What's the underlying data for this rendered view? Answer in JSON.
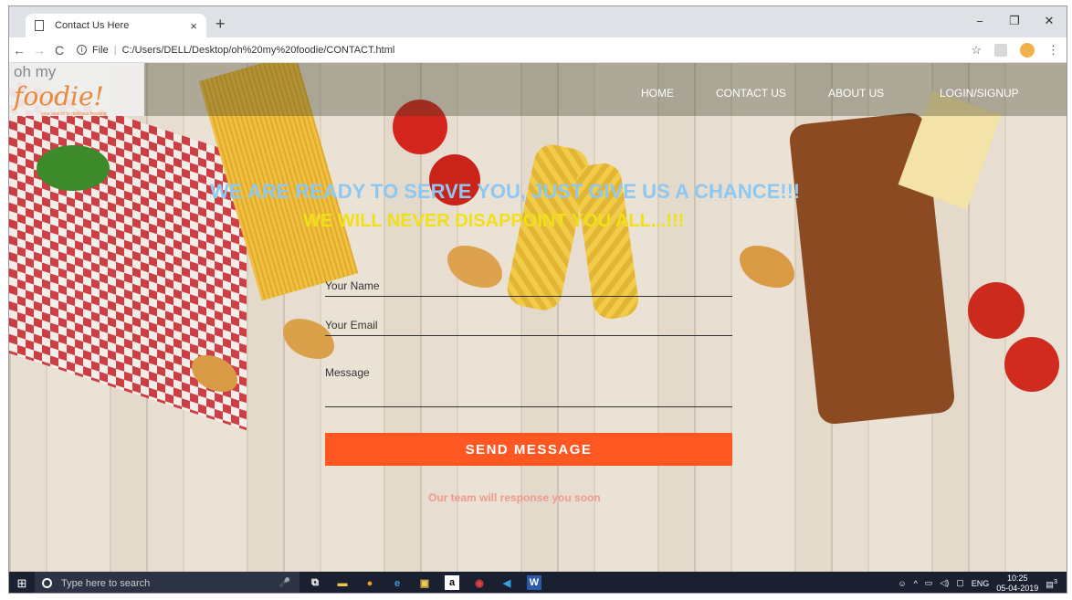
{
  "browser": {
    "tab_title": "Contact Us Here",
    "tab_close": "×",
    "new_tab": "+",
    "address_scheme": "File",
    "address_url": "C:/Users/DELL/Desktop/oh%20my%20foodie/CONTACT.html",
    "win_min": "−",
    "win_max": "❐",
    "win_close": "✕"
  },
  "site": {
    "logo_prefix": "oh my",
    "logo_brand": "foodie!",
    "logo_tagline": "your search to delicious feasting",
    "nav": [
      "HOME",
      "CONTACT US",
      "ABOUT US",
      "LOGIN/SIGNUP"
    ],
    "heading1": "WE ARE READY TO SERVE YOU, JUST GIVE US A CHANCE!!!",
    "heading2": "WE WILL NEVER DISAPPOINT YOU ALL...!!!",
    "form": {
      "name_placeholder": "Your Name",
      "email_placeholder": "Your Email",
      "message_placeholder": "Message",
      "send_label": "SEND MESSAGE"
    },
    "note": "Our team will response you soon"
  },
  "taskbar": {
    "search_placeholder": "Type here to search",
    "lang": "ENG",
    "time": "10:25",
    "date": "05-04-2019",
    "notif_count": "3"
  },
  "colors": {
    "accent": "#ff5722",
    "heading1": "#8ec8f0",
    "heading2": "#f0e018"
  }
}
